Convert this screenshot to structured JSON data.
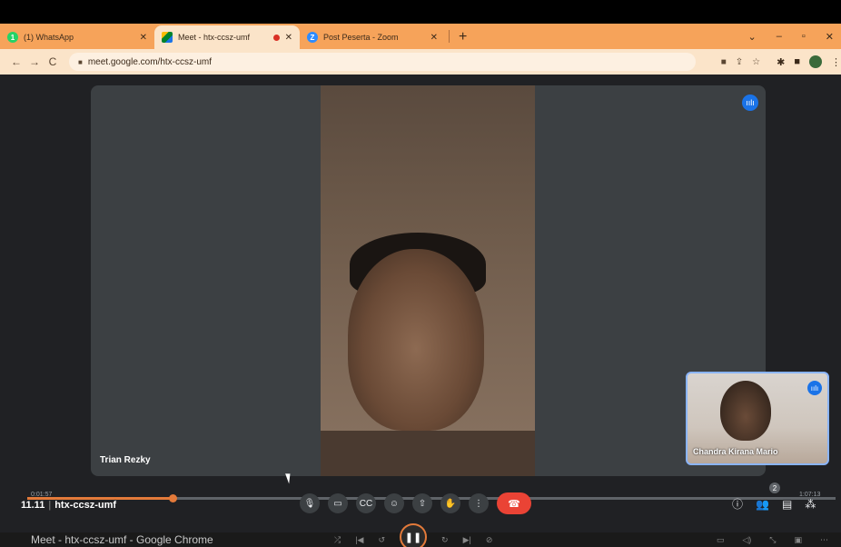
{
  "browser": {
    "tabs": [
      {
        "title": "(1) WhatsApp",
        "favicon": "whatsapp-icon",
        "favicon_color": "#25d366",
        "badge": "1"
      },
      {
        "title": "Meet - htx-ccsz-umf",
        "favicon": "meet-icon",
        "favicon_color": "#00832d",
        "recording": true
      },
      {
        "title": "Post Peserta - Zoom",
        "favicon": "zoom-icon",
        "favicon_color": "#2d8cff"
      }
    ],
    "new_tab": "+",
    "url": "meet.google.com/htx-ccsz-umf",
    "theme_color": "#f6a35a"
  },
  "meet": {
    "main_participant": "Trian Rezky",
    "self_participant": "Chandra Kirana Mario",
    "meeting_code": "htx-ccsz-umf",
    "time": "11.11",
    "people_count": "2"
  },
  "player": {
    "time_left": "0:01:57",
    "time_right": "1:07:13",
    "progress": 0.18,
    "accent": "#e37a3a"
  },
  "taskbar": {
    "window_title": "Meet - htx-ccsz-umf - Google Chrome"
  }
}
